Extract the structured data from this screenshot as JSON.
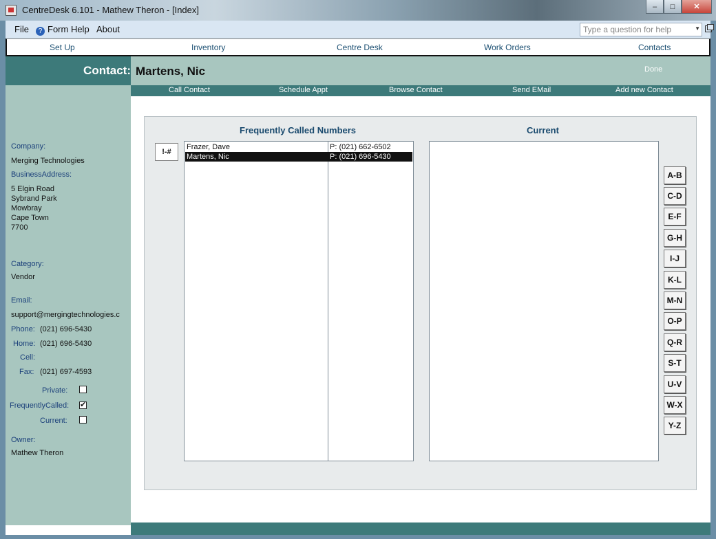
{
  "window": {
    "title": "CentreDesk 6.101 - Mathew Theron - [Index]",
    "min": "–",
    "max": "□",
    "close": "✕"
  },
  "menu": {
    "file": "File",
    "form_help": "Form Help",
    "about": "About",
    "ask_placeholder": "Type a question for help"
  },
  "nav": [
    "Set Up",
    "Inventory",
    "Centre Desk",
    "Work Orders",
    "Contacts"
  ],
  "header": {
    "label": "Contact:",
    "name": "Martens, Nic",
    "done": "Done"
  },
  "actions": [
    "Call Contact",
    "Schedule Appt",
    "Browse Contact",
    "Send EMail",
    "Add new Contact"
  ],
  "details": {
    "company_label": "Company:",
    "company": "Merging Technologies",
    "address_label": "BusinessAddress:",
    "address": [
      "5 Elgin Road",
      "Sybrand Park",
      "Mowbray",
      "Cape Town",
      "7700"
    ],
    "category_label": "Category:",
    "category": "Vendor",
    "email_label": "Email:",
    "email": "support@mergingtechnologies.c",
    "phone_label": "Phone:",
    "phone": "(021) 696-5430",
    "home_label": "Home:",
    "home": "(021) 696-5430",
    "cell_label": "Cell:",
    "fax_label": "Fax:",
    "fax": "(021) 697-4593",
    "private_label": "Private:",
    "private": false,
    "frequent_label": "FrequentlyCalled:",
    "frequent": true,
    "current_label": "Current:",
    "current": false,
    "owner_label": "Owner:",
    "owner": "Mathew Theron"
  },
  "panel": {
    "freq_title": "Frequently Called Numbers",
    "current_title": "Current",
    "symbol_button": "!-#",
    "rows": [
      {
        "name": "Frazer, Dave",
        "phone": "P: (021) 662-6502",
        "selected": false
      },
      {
        "name": "Martens, Nic",
        "phone": "P: (021) 696-5430",
        "selected": true
      }
    ],
    "alpha": [
      "A-B",
      "C-D",
      "E-F",
      "G-H",
      "I-J",
      "K-L",
      "M-N",
      "O-P",
      "Q-R",
      "S-T",
      "U-V",
      "W-X",
      "Y-Z"
    ]
  }
}
